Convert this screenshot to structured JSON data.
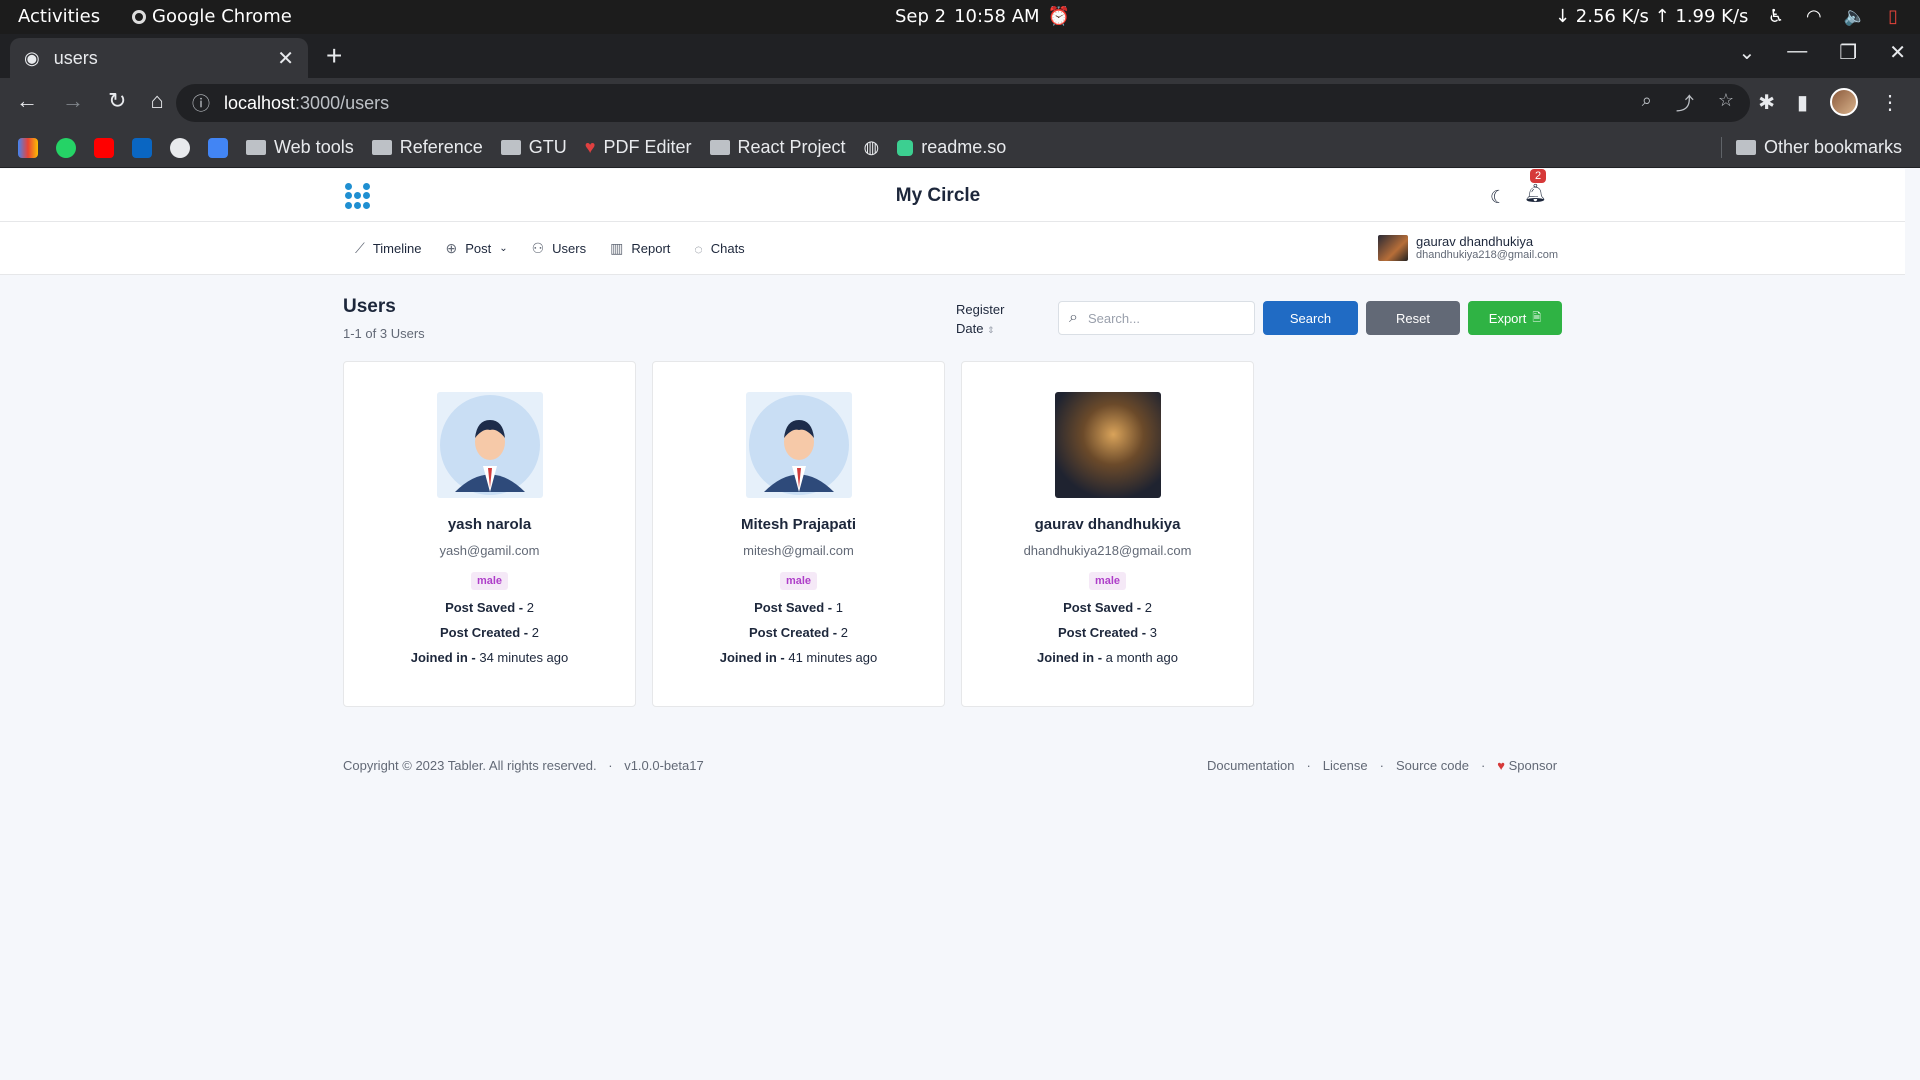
{
  "os": {
    "activities": "Activities",
    "app_name": "Google Chrome",
    "date": "Sep 2",
    "time": "10:58 AM",
    "network_speed": "↓ 2.56 K/s ↑ 1.99 K/s"
  },
  "browser": {
    "tab_title": "users",
    "url_host": "localhost",
    "url_path": ":3000/users",
    "bookmarks": [
      "Web tools",
      "Reference",
      "GTU",
      "PDF Editer",
      "React Project",
      "readme.so"
    ],
    "other_bookmarks": "Other bookmarks"
  },
  "app": {
    "brand": "My Circle",
    "notification_count": "2",
    "nav": [
      {
        "label": "Timeline",
        "icon": "trend-icon"
      },
      {
        "label": "Post",
        "icon": "plus-circle-icon"
      },
      {
        "label": "Users",
        "icon": "users-icon"
      },
      {
        "label": "Report",
        "icon": "report-icon"
      },
      {
        "label": "Chats",
        "icon": "chat-icon"
      }
    ],
    "current_user": {
      "name": "gaurav dhandhukiya",
      "email": "dhandhukiya218@gmail.com"
    }
  },
  "page": {
    "title": "Users",
    "subtitle": "1-1 of 3 Users",
    "sort_label_1": "Register",
    "sort_label_2": "Date",
    "search_placeholder": "Search...",
    "search_button": "Search",
    "reset_button": "Reset",
    "export_button": "Export"
  },
  "users": [
    {
      "name": "yash narola",
      "email": "yash@gamil.com",
      "gender": "male",
      "saved_label": "Post Saved - ",
      "saved": "2",
      "created_label": "Post Created - ",
      "created": "2",
      "joined_label": "Joined in - ",
      "joined": "34 minutes ago"
    },
    {
      "name": "Mitesh Prajapati",
      "email": "mitesh@gmail.com",
      "gender": "male",
      "saved_label": "Post Saved - ",
      "saved": "1",
      "created_label": "Post Created - ",
      "created": "2",
      "joined_label": "Joined in - ",
      "joined": "41 minutes ago"
    },
    {
      "name": "gaurav dhandhukiya",
      "email": "dhandhukiya218@gmail.com",
      "gender": "male",
      "saved_label": "Post Saved - ",
      "saved": "2",
      "created_label": "Post Created - ",
      "created": "3",
      "joined_label": "Joined in - ",
      "joined": "a month ago"
    }
  ],
  "footer": {
    "copyright": "Copyright © 2023 Tabler. All rights reserved.",
    "version": "v1.0.0-beta17",
    "links": [
      "Documentation",
      "License",
      "Source code",
      "Sponsor"
    ]
  },
  "colors": {
    "primary": "#206bc4",
    "secondary": "#626976",
    "success": "#2fb344",
    "badge_purple": "#ae3ec9"
  }
}
